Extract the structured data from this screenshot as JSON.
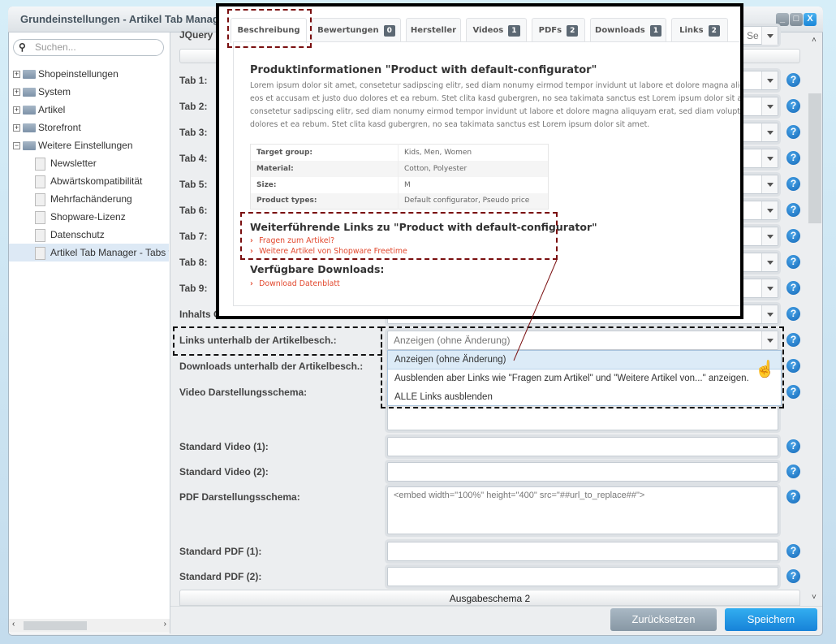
{
  "window": {
    "title": "Grundeinstellungen - Artikel Tab Manager - Tabs frei definierbar",
    "minimize": "_",
    "maximize": "□",
    "close": "X"
  },
  "sidebar": {
    "search_placeholder": "Suchen...",
    "items": [
      {
        "label": "Shopeinstellungen",
        "type": "folder",
        "expanded": false
      },
      {
        "label": "System",
        "type": "folder",
        "expanded": false
      },
      {
        "label": "Artikel",
        "type": "folder",
        "expanded": false
      },
      {
        "label": "Storefront",
        "type": "folder",
        "expanded": false
      },
      {
        "label": "Weitere Einstellungen",
        "type": "folder",
        "expanded": true
      }
    ],
    "children": [
      "Newsletter",
      "Abwärtskompatibilität",
      "Mehrfachänderung",
      "Shopware-Lizenz",
      "Datenschutz",
      "Artikel Tab Manager - Tabs frei"
    ]
  },
  "form": {
    "top_label": "JQuery V",
    "top_select_value": "Se",
    "tabs": [
      "Tab 1:",
      "Tab 2:",
      "Tab 3:",
      "Tab 4:",
      "Tab 5:",
      "Tab 6:",
      "Tab 7:",
      "Tab 8:",
      "Tab 9:"
    ],
    "inhalts_label": "Inhalts C",
    "links_label": "Links unterhalb der Artikelbesch.:",
    "links_value": "Anzeigen (ohne Änderung)",
    "links_options": [
      "Anzeigen (ohne Änderung)",
      "Ausblenden aber Links wie \"Fragen zum Artikel\" und \"Weitere Artikel von...\" anzeigen.",
      "ALLE Links ausblenden"
    ],
    "downloads_label": "Downloads unterhalb der Artikelbesch.:",
    "video_schema_label": "Video Darstellungsschema:",
    "std_video1_label": "Standard Video (1):",
    "std_video2_label": "Standard Video (2):",
    "pdf_schema_label": "PDF Darstellungsschema:",
    "pdf_schema_value": "<embed width=\"100%\" height=\"400\" src=\"##url_to_replace##\">",
    "std_pdf1_label": "Standard PDF (1):",
    "std_pdf2_label": "Standard PDF (2):",
    "section": "Ausgabeschema 2",
    "help": "?"
  },
  "footer": {
    "reset": "Zurücksetzen",
    "save": "Speichern"
  },
  "preview": {
    "tabs": [
      {
        "label": "Beschreibung"
      },
      {
        "label": "Bewertungen",
        "count": "0"
      },
      {
        "label": "Hersteller"
      },
      {
        "label": "Videos",
        "count": "1"
      },
      {
        "label": "PDFs",
        "count": "2"
      },
      {
        "label": "Downloads",
        "count": "1"
      },
      {
        "label": "Links",
        "count": "2"
      }
    ],
    "heading": "Produktinformationen \"Product with default-configurator\"",
    "lorem": [
      "Lorem ipsum dolor sit amet, consetetur sadipscing elitr, sed diam nonumy eirmod tempor invidunt ut labore et dolore magna aliquyam erat",
      "eos et accusam et justo duo dolores et ea rebum. Stet clita kasd gubergren, no sea takimata sanctus est Lorem ipsum dolor sit amet. Lorem",
      "consetetur sadipscing elitr, sed diam nonumy eirmod tempor invidunt ut labore et dolore magna aliquyam erat, sed diam voluptua. At vero",
      "dolores et ea rebum. Stet clita kasd gubergren, no sea takimata sanctus est Lorem ipsum dolor sit amet."
    ],
    "properties": [
      [
        "Target group:",
        "Kids, Men, Women"
      ],
      [
        "Material:",
        "Cotton, Polyester"
      ],
      [
        "Size:",
        "M"
      ],
      [
        "Product types:",
        "Default configurator, Pseudo price"
      ]
    ],
    "links_heading": "Weiterführende Links zu \"Product with default-configurator\"",
    "links": [
      "Fragen zum Artikel?",
      "Weitere Artikel von Shopware Freetime"
    ],
    "downloads_heading": "Verfügbare Downloads:",
    "downloads": [
      "Download Datenblatt"
    ]
  },
  "colors": {
    "accent": "#1a8be0",
    "link": "#e2492f",
    "annotation": "#7a0f10"
  }
}
